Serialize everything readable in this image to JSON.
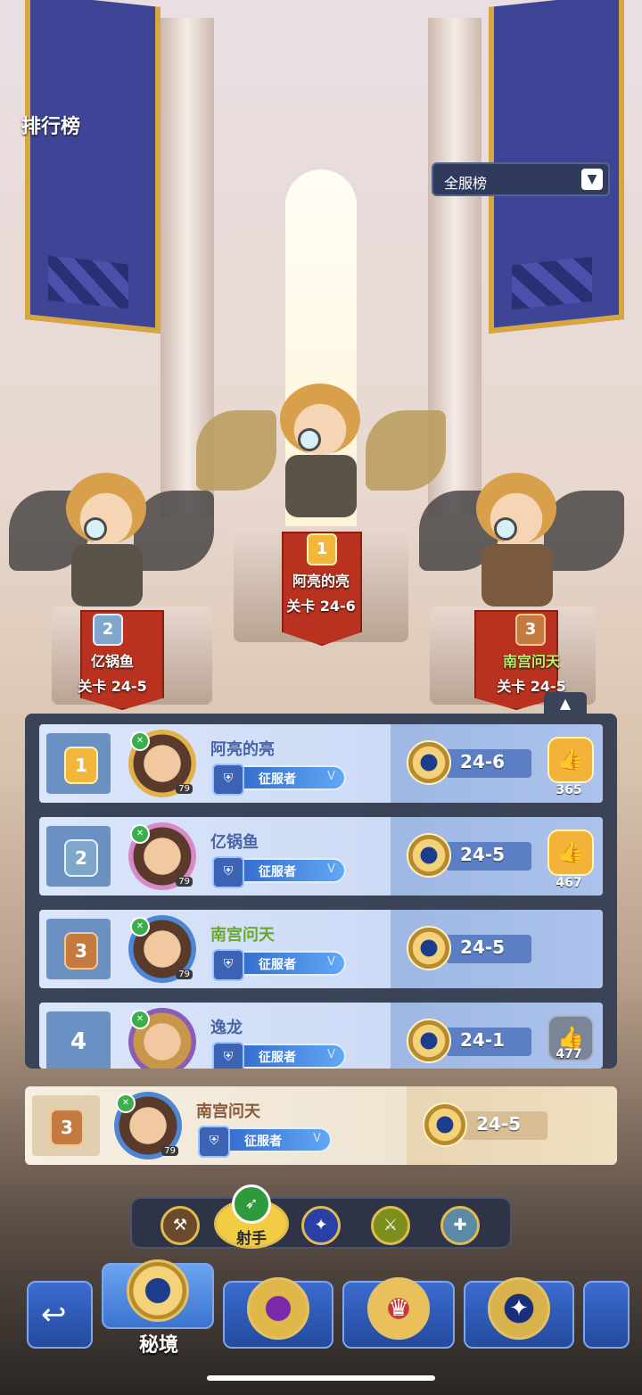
{
  "header": {
    "title": "排行榜",
    "dropdown_value": "全服榜"
  },
  "podium": [
    {
      "place": "1",
      "name": "阿亮的亮",
      "stage": "关卡 24-6",
      "highlight": false
    },
    {
      "place": "2",
      "name": "亿锅鱼",
      "stage": "关卡 24-5",
      "highlight": false
    },
    {
      "place": "3",
      "name": "南宫问天",
      "stage": "关卡 24-5",
      "highlight": true
    }
  ],
  "rows": [
    {
      "rank": "1",
      "name": "阿亮的亮",
      "level": "79",
      "title": "征服者",
      "title_tier": "V",
      "stage": "24-6",
      "likes": "365"
    },
    {
      "rank": "2",
      "name": "亿锅鱼",
      "level": "79",
      "title": "征服者",
      "title_tier": "V",
      "stage": "24-5",
      "likes": "467"
    },
    {
      "rank": "3",
      "name": "南宫问天",
      "level": "79",
      "title": "征服者",
      "title_tier": "V",
      "stage": "24-5",
      "likes": ""
    },
    {
      "rank": "4",
      "name": "逸龙",
      "level": "",
      "title": "征服者",
      "title_tier": "V",
      "stage": "24-1",
      "likes": "477"
    }
  ],
  "my_row": {
    "rank": "3",
    "name": "南宫问天",
    "level": "79",
    "title": "征服者",
    "title_tier": "V",
    "stage": "24-5"
  },
  "class_filter": {
    "selected_label": "射手"
  },
  "bottom_nav": {
    "active_label": "秘境"
  },
  "icons": {
    "collapse": "chevron-up-icon",
    "dropdown": "chevron-down-icon",
    "like": "thumbs-up-icon",
    "back": "return-arrow-icon"
  },
  "colors": {
    "panel": "#3a4358",
    "gold": "#f2b63a",
    "silver": "#7fa7cc",
    "bronze": "#c57a3f",
    "like": "#f3b33b"
  }
}
